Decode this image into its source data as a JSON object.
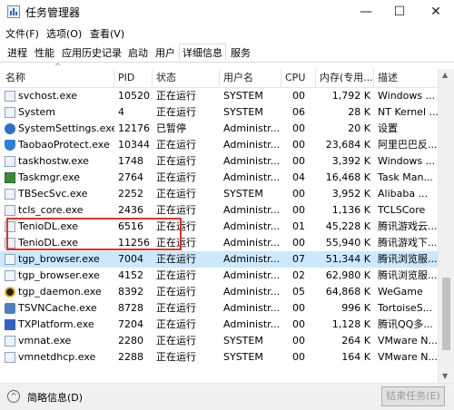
{
  "window": {
    "title": "任务管理器",
    "minimize_glyph": "—",
    "maximize_glyph": "☐",
    "close_glyph": "✕"
  },
  "menu": [
    "文件(F)",
    "选项(O)",
    "查看(V)"
  ],
  "tabs": [
    "进程",
    "性能",
    "应用历史记录",
    "启动",
    "用户",
    "详细信息",
    "服务"
  ],
  "active_tab": "详细信息",
  "columns": [
    "名称",
    "PID",
    "状态",
    "用户名",
    "CPU",
    "内存(专用...",
    "描述"
  ],
  "sort_indicator": "^",
  "rows": [
    {
      "icon": "window-icon",
      "name": "svchost.exe",
      "pid": "10520",
      "status": "正在运行",
      "user": "SYSTEM",
      "cpu": "00",
      "mem": "1,792 K",
      "desc": "Windows ..."
    },
    {
      "icon": "window-icon",
      "name": "System",
      "pid": "4",
      "status": "正在运行",
      "user": "SYSTEM",
      "cpu": "06",
      "mem": "28 K",
      "desc": "NT Kernel ..."
    },
    {
      "icon": "gear-icon",
      "name": "SystemSettings.exe",
      "pid": "12176",
      "status": "已暂停",
      "user": "Administr...",
      "cpu": "00",
      "mem": "20 K",
      "desc": "设置"
    },
    {
      "icon": "shield-icon",
      "name": "TaobaoProtect.exe",
      "pid": "10344",
      "status": "正在运行",
      "user": "Administr...",
      "cpu": "00",
      "mem": "23,684 K",
      "desc": "阿里巴巴反..."
    },
    {
      "icon": "window-icon",
      "name": "taskhostw.exe",
      "pid": "1748",
      "status": "正在运行",
      "user": "Administr...",
      "cpu": "00",
      "mem": "3,392 K",
      "desc": "Windows ..."
    },
    {
      "icon": "task-manager-icon",
      "name": "Taskmgr.exe",
      "pid": "2764",
      "status": "正在运行",
      "user": "Administr...",
      "cpu": "04",
      "mem": "16,468 K",
      "desc": "Task Man..."
    },
    {
      "icon": "window-icon",
      "name": "TBSecSvc.exe",
      "pid": "2252",
      "status": "正在运行",
      "user": "SYSTEM",
      "cpu": "00",
      "mem": "3,952 K",
      "desc": "Alibaba ..."
    },
    {
      "icon": "window-icon",
      "name": "tcls_core.exe",
      "pid": "2436",
      "status": "正在运行",
      "user": "Administr...",
      "cpu": "00",
      "mem": "1,136 K",
      "desc": "TCLSCore"
    },
    {
      "icon": "window-icon",
      "name": "TenioDL.exe",
      "pid": "6516",
      "status": "正在运行",
      "user": "Administr...",
      "cpu": "01",
      "mem": "45,228 K",
      "desc": "腾讯游戏云..."
    },
    {
      "icon": "window-icon",
      "name": "TenioDL.exe",
      "pid": "11256",
      "status": "正在运行",
      "user": "Administr...",
      "cpu": "00",
      "mem": "55,940 K",
      "desc": "腾讯游戏下..."
    },
    {
      "icon": "browser-window-icon",
      "name": "tgp_browser.exe",
      "pid": "7004",
      "status": "正在运行",
      "user": "Administr...",
      "cpu": "07",
      "mem": "51,344 K",
      "desc": "腾讯浏览服...",
      "selected": true
    },
    {
      "icon": "browser-window-icon",
      "name": "tgp_browser.exe",
      "pid": "4152",
      "status": "正在运行",
      "user": "Administr...",
      "cpu": "02",
      "mem": "62,980 K",
      "desc": "腾讯浏览服..."
    },
    {
      "icon": "daemon-icon",
      "name": "tgp_daemon.exe",
      "pid": "8392",
      "status": "正在运行",
      "user": "Administr...",
      "cpu": "05",
      "mem": "64,868 K",
      "desc": "WeGame"
    },
    {
      "icon": "tortoise-icon",
      "name": "TSVNCache.exe",
      "pid": "8728",
      "status": "正在运行",
      "user": "Administr...",
      "cpu": "00",
      "mem": "996 K",
      "desc": "TortoiseS..."
    },
    {
      "icon": "txplatform-icon",
      "name": "TXPlatform.exe",
      "pid": "7204",
      "status": "正在运行",
      "user": "Administr...",
      "cpu": "00",
      "mem": "1,128 K",
      "desc": "腾讯QQ多..."
    },
    {
      "icon": "window-icon",
      "name": "vmnat.exe",
      "pid": "2280",
      "status": "正在运行",
      "user": "SYSTEM",
      "cpu": "00",
      "mem": "264 K",
      "desc": "VMware N..."
    },
    {
      "icon": "window-icon",
      "name": "vmnetdhcp.exe",
      "pid": "2288",
      "status": "正在运行",
      "user": "SYSTEM",
      "cpu": "00",
      "mem": "164 K",
      "desc": "VMware N..."
    }
  ],
  "footer": {
    "fewer_details_glyph": "^",
    "fewer_details_label": "简略信息(D)",
    "end_task_label": "结束任务(E)"
  },
  "colors": {
    "selected_row": "#cce8ff",
    "highlight_box": "#e0322b"
  }
}
